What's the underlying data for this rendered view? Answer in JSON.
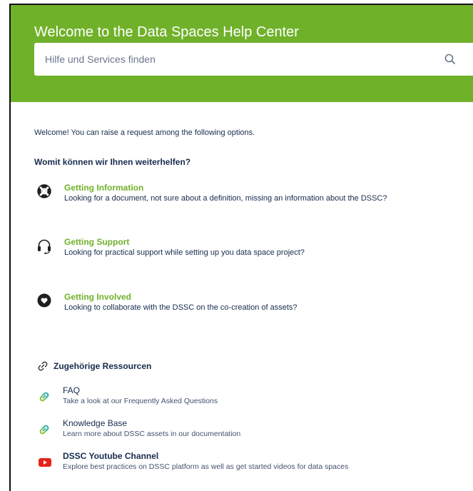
{
  "header": {
    "title": "Welcome to the Data Spaces Help Center",
    "background_color": "#70b12a"
  },
  "search": {
    "placeholder": "Hilfe und Services finden",
    "icon": "search-icon"
  },
  "intro": {
    "welcome_text": "Welcome! You can raise a request among the following options.",
    "question": "Womit können wir Ihnen weiterhelfen?"
  },
  "options": [
    {
      "title": "Getting Information",
      "description": "Looking for a document, not sure about a definition, missing an information about the DSSC?",
      "icon": "lifebuoy-icon"
    },
    {
      "title": "Getting Support",
      "description": "Looking for practical support while setting up you data space project?",
      "icon": "headset-icon"
    },
    {
      "title": "Getting Involved",
      "description": "Looking to collaborate with the DSSC on the co-creation of assets?",
      "icon": "heart-icon"
    }
  ],
  "resources": {
    "heading": "Zugehörige Ressourcen",
    "heading_icon": "link-icon",
    "items": [
      {
        "title": "FAQ",
        "description": "Take a look at our Frequently Asked Questions",
        "icon": "link-icon"
      },
      {
        "title": "Knowledge Base",
        "description": "Learn more about DSSC assets in our documentation",
        "icon": "link-icon"
      },
      {
        "title": "DSSC Youtube Channel",
        "description": "Explore best practices on DSSC platform as well as get started videos for data spaces",
        "icon": "youtube-icon"
      }
    ]
  },
  "colors": {
    "accent": "#70b12a",
    "text": "#172b4d",
    "link_icon_teal": "#3bb3a7",
    "link_icon_green": "#8cc63f",
    "youtube_red": "#e62117"
  }
}
